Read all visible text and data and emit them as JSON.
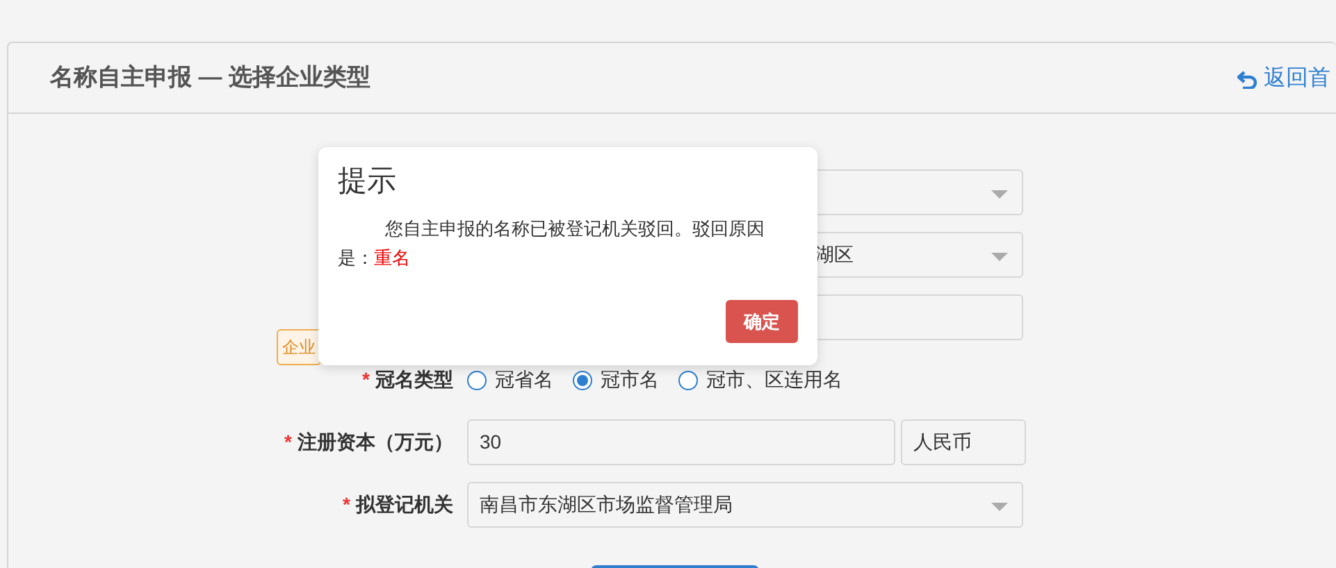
{
  "header": {
    "title": "名称自主申报 — 选择企业类型",
    "back_link": "返回首"
  },
  "form": {
    "rows": [
      {
        "kind": "select"
      },
      {
        "kind": "select",
        "value": "湖区"
      },
      {
        "kind": "input"
      },
      {
        "kind": "radio",
        "required_mark": "*",
        "label": "冠名类型",
        "options": [
          {
            "label": "冠省名",
            "selected": false
          },
          {
            "label": "冠市名",
            "selected": true
          },
          {
            "label": "冠市、区连用名",
            "selected": false
          }
        ]
      },
      {
        "kind": "currency",
        "required_mark": "*",
        "label": "注册资本（万元）",
        "value": "30",
        "unit": "人民币"
      },
      {
        "kind": "select",
        "required_mark": "*",
        "label": "拟登记机关",
        "value": "南昌市东湖区市场监督管理局"
      }
    ],
    "tag": "企业"
  },
  "dialog": {
    "title": "提示",
    "message": "您自主申报的名称已被登记机关驳回。驳回原因是：",
    "reason": "重名",
    "button": "确定"
  }
}
